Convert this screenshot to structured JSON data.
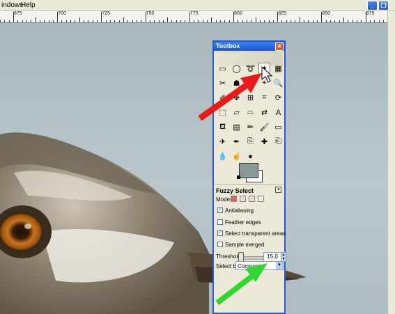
{
  "menu": {
    "items": [
      "indows",
      "Help"
    ]
  },
  "window_controls": [
    "_",
    "❐",
    "✕"
  ],
  "ruler": {
    "labels": [
      "675",
      "700",
      "725",
      "750",
      "775",
      "800",
      "825",
      "850",
      "875"
    ]
  },
  "toolbox": {
    "title": "Toolbox",
    "close": "✕",
    "tool_options": {
      "title": "Fuzzy Select",
      "menu": "◂",
      "mode_label": "Mode:",
      "checkboxes": [
        {
          "label": "Antialiasing",
          "checked": true
        },
        {
          "label": "Feather edges",
          "checked": false
        },
        {
          "label": "Select transparent areas",
          "checked": true
        },
        {
          "label": "Sample merged",
          "checked": false
        }
      ],
      "threshold_label": "Threshold:",
      "threshold_value": "15,0",
      "select_by_label": "Select by:",
      "select_by_value": "Composite"
    }
  },
  "colors": {
    "fg": "#8a9a9b",
    "bg": "#ffffff",
    "accent": "#2a5bd7"
  },
  "annotations": {
    "red_arrow_color": "#ea1a1a",
    "green_arrow_color": "#2ed62e"
  }
}
